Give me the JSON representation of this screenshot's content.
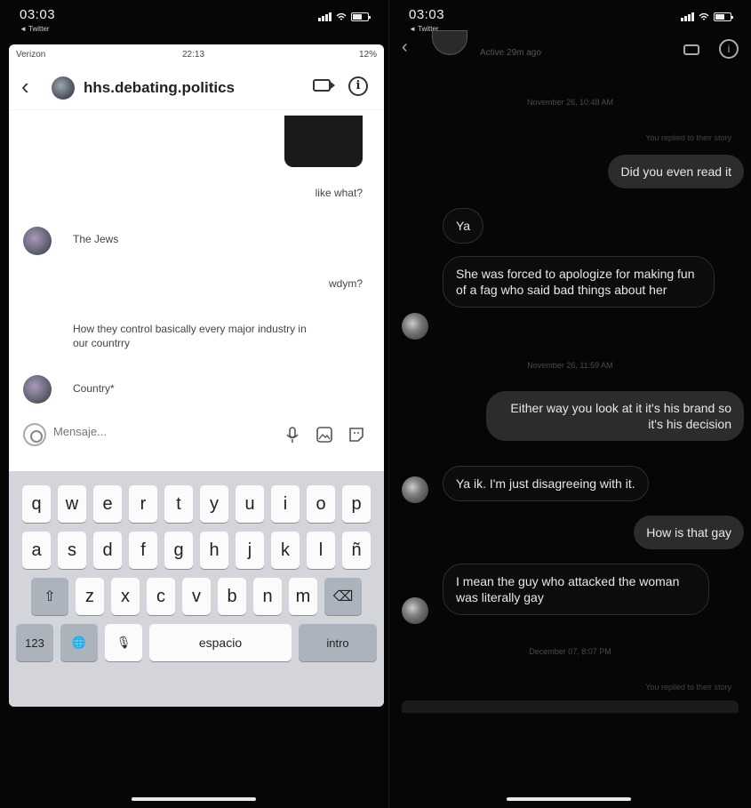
{
  "left": {
    "outer_status": {
      "time": "03:03",
      "back": "◄ Twitter"
    },
    "inner_status": {
      "carrier": "Verizon",
      "clock": "22:13",
      "battery": "12%"
    },
    "header": {
      "name": "hhs.debating.politics"
    },
    "messages": [
      {
        "side": "right",
        "text": "like what?"
      },
      {
        "side": "left",
        "text": "The Jews"
      },
      {
        "side": "right",
        "text": "wdym?"
      },
      {
        "side": "left",
        "text": "How they control basically every major industry in our countrry"
      },
      {
        "side": "left",
        "text": "Country*"
      }
    ],
    "composer": {
      "placeholder": "Mensaje..."
    },
    "keyboard": {
      "row1": [
        "q",
        "w",
        "e",
        "r",
        "t",
        "y",
        "u",
        "i",
        "o",
        "p"
      ],
      "row2": [
        "a",
        "s",
        "d",
        "f",
        "g",
        "h",
        "j",
        "k",
        "l",
        "ñ"
      ],
      "row3": [
        "z",
        "x",
        "c",
        "v",
        "b",
        "n",
        "m"
      ],
      "shift": "⇧",
      "delete": "⌫",
      "num": "123",
      "globe": "🌐",
      "mic": "🎙",
      "space": "espacio",
      "intro": "intro"
    }
  },
  "right": {
    "outer_status": {
      "time": "03:03",
      "back": "◄ Twitter"
    },
    "header": {
      "status": "Active 29m ago"
    },
    "dates": [
      "November 26, 10:48 AM",
      "November 26, 11:59 AM",
      "December 07, 8:07 PM"
    ],
    "replied_note": "You replied to their story",
    "messages": [
      {
        "side": "me",
        "text": "Did you even read it"
      },
      {
        "side": "them",
        "text": "Ya"
      },
      {
        "side": "them",
        "text": "She was forced to apologize for making fun of a fag who said bad things about her"
      },
      {
        "side": "me",
        "text": "Either way you look at it it's his brand so it's his decision"
      },
      {
        "side": "them",
        "text": "Ya ik. I'm just disagreeing with it."
      },
      {
        "side": "me",
        "text": "How is that gay"
      },
      {
        "side": "them",
        "text": "I mean the guy who attacked the woman was literally gay"
      }
    ],
    "replied_note_2": "You replied to their story"
  }
}
